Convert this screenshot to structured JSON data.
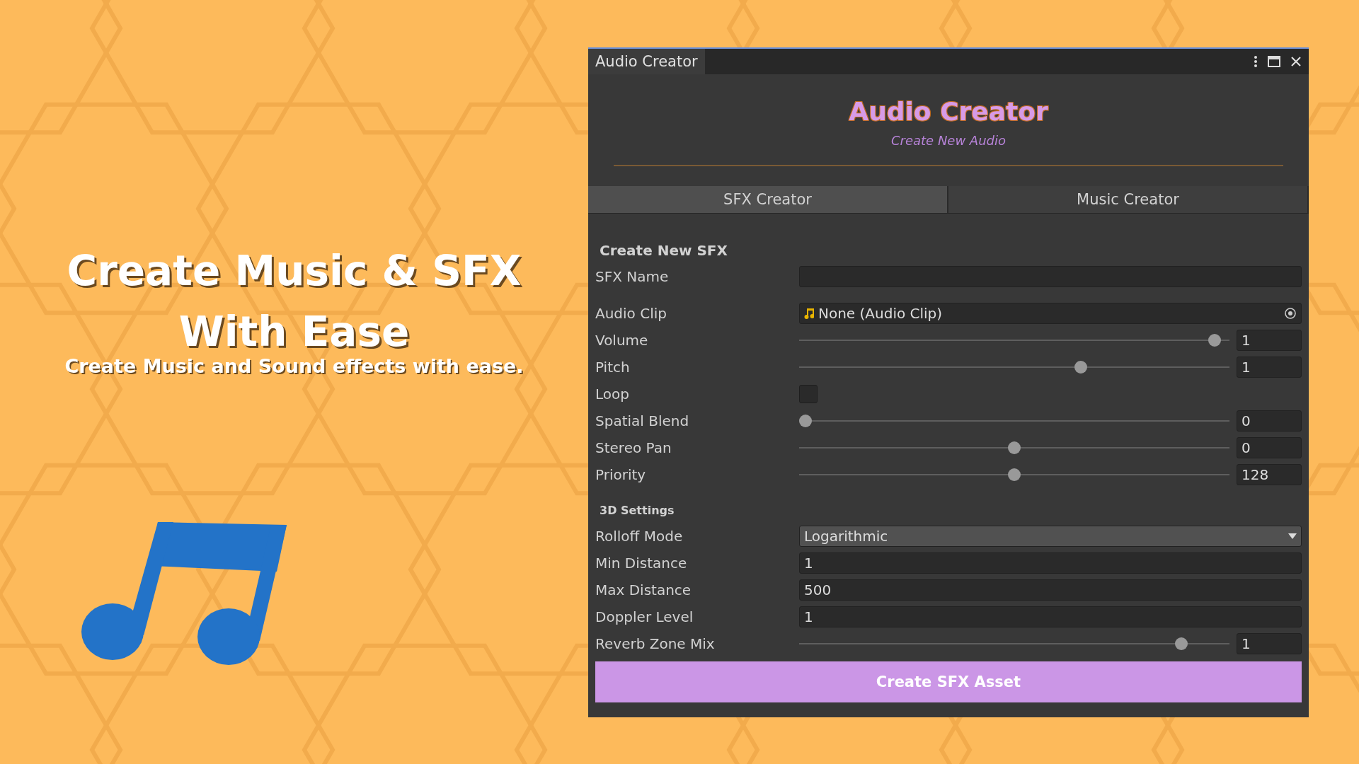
{
  "hero": {
    "title_lines": [
      "Create Music & SFX",
      "With Ease"
    ],
    "subtitle": "Create Music and Sound effects with ease."
  },
  "window": {
    "title": "Audio Creator",
    "header": {
      "title": "Audio Creator",
      "subtitle": "Create New Audio"
    },
    "tabs": [
      {
        "label": "SFX Creator",
        "selected": true
      },
      {
        "label": "Music Creator",
        "selected": false
      }
    ],
    "sections": [
      {
        "heading": "Create New SFX",
        "rows": [
          {
            "kind": "text",
            "label": "SFX Name"
          },
          {
            "kind": "object",
            "label": "Audio Clip",
            "value": "None (Audio Clip)"
          },
          {
            "kind": "slider",
            "label": "Volume",
            "level": 0.98,
            "value": "1"
          },
          {
            "kind": "slider",
            "label": "Pitch",
            "level": 0.66,
            "value": "1"
          },
          {
            "kind": "checkbox",
            "label": "Loop",
            "checked": false
          },
          {
            "kind": "slider",
            "label": "Spatial Blend",
            "level": 0,
            "value": "0"
          },
          {
            "kind": "slider",
            "label": "Stereo Pan",
            "level": 0.5,
            "value": "0"
          },
          {
            "kind": "slider",
            "label": "Priority",
            "level": 0.5,
            "value": "128"
          }
        ]
      },
      {
        "heading": "3D Settings",
        "rows": [
          {
            "kind": "dropdown",
            "label": "Rolloff Mode",
            "value": "Logarithmic"
          },
          {
            "kind": "text",
            "label": "Min Distance",
            "value": "1"
          },
          {
            "kind": "text",
            "label": "Max Distance",
            "value": "500"
          },
          {
            "kind": "text",
            "label": "Doppler Level",
            "value": "1"
          },
          {
            "kind": "slider",
            "label": "Reverb Zone Mix",
            "level": 0.9,
            "value": "1"
          }
        ]
      }
    ],
    "button": "Create SFX Asset"
  }
}
